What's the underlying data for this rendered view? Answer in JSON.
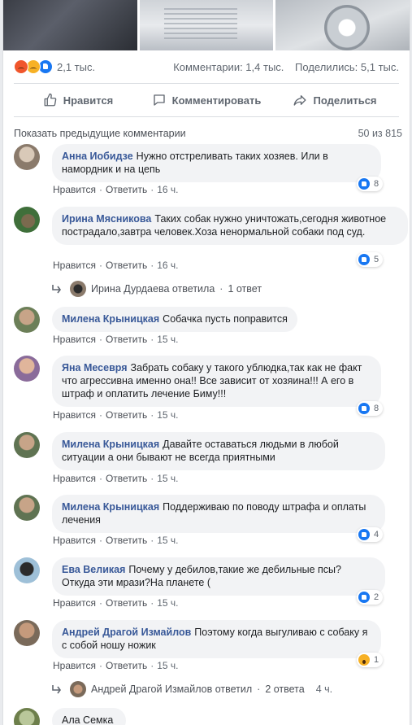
{
  "post": {
    "reactions_count": "2,1 тыс.",
    "comments_count": "Комментарии: 1,4 тыс.",
    "shares_count": "Поделились: 5,1 тыс."
  },
  "actions": {
    "like": "Нравится",
    "comment": "Комментировать",
    "share": "Поделиться"
  },
  "comments_header": {
    "show_previous": "Показать предыдущие комментарии",
    "count": "50 из 815"
  },
  "comments": [
    {
      "author": "Анна Иобидзе",
      "text": "Нужно отстреливать таких хозяев. Или в намордник и на цепь",
      "like": "Нравится",
      "reply": "Ответить",
      "time": "16 ч.",
      "reaction_count": "8"
    },
    {
      "author": "Ирина Мясникова",
      "text": "Таких собак нужно уничтожать,сегодня животное пострадало,завтра человек.Хоза ненормальной собаки под суд.",
      "like": "Нравится",
      "reply": "Ответить",
      "time": "16 ч.",
      "reaction_count": "5",
      "reply_thread": {
        "name": "Ирина Дурдаева ответила",
        "count": "1 ответ"
      }
    },
    {
      "author": "Милена Крыницкая",
      "text": "Собачка пусть поправится",
      "like": "Нравится",
      "reply": "Ответить",
      "time": "15 ч."
    },
    {
      "author": "Яна Месевря",
      "text": "Забрать собаку у такого ублюдка,так как не факт что агрессивна именно она!! Все зависит от хозяина!!! А его в штраф и оплатить лечение Биму!!!",
      "like": "Нравится",
      "reply": "Ответить",
      "time": "15 ч.",
      "reaction_count": "8"
    },
    {
      "author": "Милена Крыницкая",
      "text": "Давайте оставаться людьми в любой ситуации а они бывают не всегда приятными",
      "like": "Нравится",
      "reply": "Ответить",
      "time": "15 ч."
    },
    {
      "author": "Милена Крыницкая",
      "text": "Поддерживаю по поводу штрафа и оплаты лечения",
      "like": "Нравится",
      "reply": "Ответить",
      "time": "15 ч.",
      "reaction_count": "4"
    },
    {
      "author": "Ева Великая",
      "text": "Почему у дебилов,такие же дебильные псы? Откуда эти мрази?На планете (",
      "like": "Нравится",
      "reply": "Ответить",
      "time": "15 ч.",
      "reaction_count": "2"
    },
    {
      "author": "Андрей Драгой Измайлов",
      "text": "Поэтому когда выгуливаю с собаку я с собой ношу ножик",
      "like": "Нравится",
      "reply": "Ответить",
      "time": "15 ч.",
      "reaction_count": "1",
      "reply_thread": {
        "name": "Андрей Драгой Измайлов ответил",
        "count": "2 ответа",
        "time": "4 ч."
      }
    },
    {
      "author": "Ала Семка"
    }
  ],
  "colors": {
    "link": "#385898",
    "like_blue": "#1877f2",
    "bubble": "#f2f3f5"
  }
}
